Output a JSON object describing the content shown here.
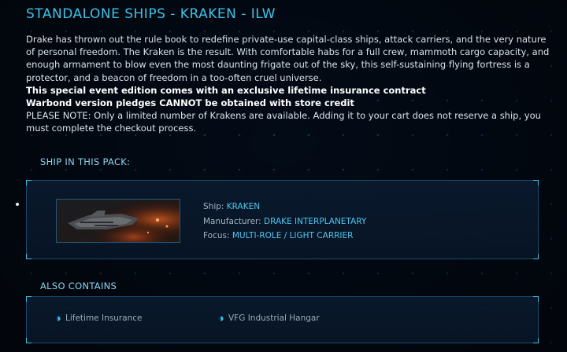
{
  "page": {
    "title": "STANDALONE SHIPS - KRAKEN - ILW",
    "description": "Drake has thrown out the rule book to redefine private-use capital-class ships, attack carriers, and the very nature of personal freedom. The Kraken is the result. With comfortable habs for a full crew, mammoth cargo capacity, and enough armament to blow even the most daunting frigate out of the sky, this self-sustaining flying fortress is a protector, and a beacon of freedom in a too-often cruel universe.",
    "note_insurance": "This special event edition comes with an exclusive lifetime insurance contract",
    "note_warbond": "Warbond version pledges CANNOT be obtained with store credit",
    "note_limited": "PLEASE NOTE: Only a limited number of Krakens are available. Adding it to your cart does not reserve a ship, you must complete the checkout process."
  },
  "ship_section": {
    "label": "SHIP IN THIS PACK:",
    "ship_label": "Ship:",
    "ship_value": "KRAKEN",
    "manufacturer_label": "Manufacturer:",
    "manufacturer_value": "DRAKE INTERPLANETARY",
    "focus_label": "Focus:",
    "focus_value": "MULTI-ROLE / LIGHT CARRIER"
  },
  "contains_section": {
    "label": "ALSO CONTAINS",
    "items": [
      "Lifetime Insurance",
      "VFG Industrial Hangar"
    ]
  },
  "colors": {
    "accent": "#3fc2e8",
    "background": "#030b17",
    "panel_border": "#1c4a6d"
  }
}
